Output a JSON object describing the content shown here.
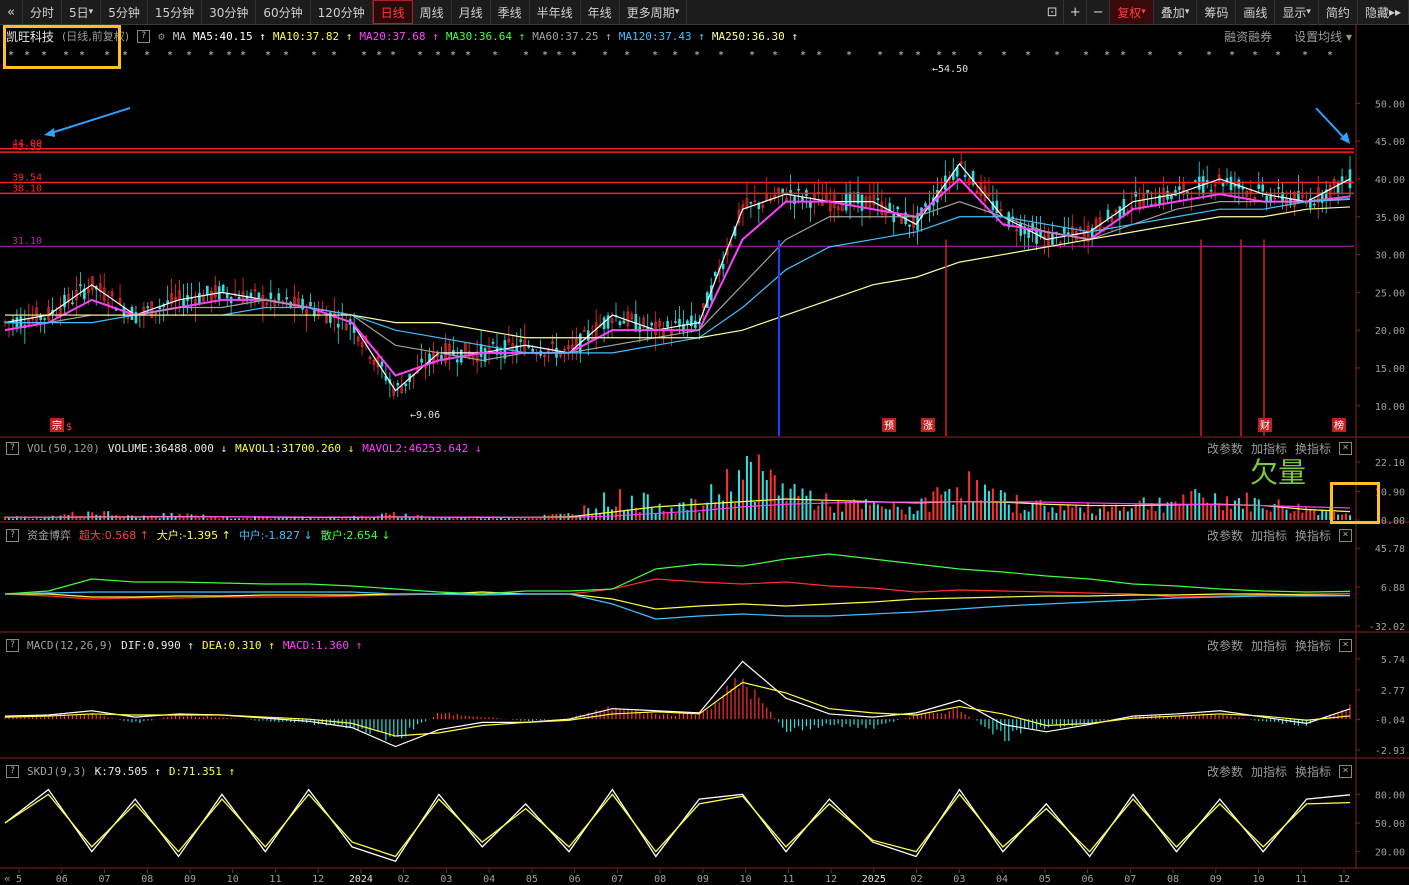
{
  "toolbar": {
    "periods": [
      "分时",
      "5日",
      "5分钟",
      "15分钟",
      "30分钟",
      "60分钟",
      "120分钟",
      "日线",
      "周线",
      "月线",
      "季线",
      "半年线",
      "年线",
      "更多周期"
    ],
    "active_period": "日线",
    "right_items": [
      "复权",
      "叠加",
      "筹码",
      "画线",
      "显示",
      "简约",
      "隐藏"
    ]
  },
  "stock": {
    "name": "凯旺科技",
    "mode": "(日线,前复权)",
    "right_links": [
      "融资融券",
      "设置均线"
    ]
  },
  "ma_legend": [
    {
      "label": "MA",
      "value": "",
      "color": "#c8c8c8"
    },
    {
      "label": "MA5:",
      "value": "40.15",
      "color": "#ffffff"
    },
    {
      "label": "MA10:",
      "value": "37.82",
      "color": "#ffff40"
    },
    {
      "label": "MA20:",
      "value": "37.68",
      "color": "#ff40ff"
    },
    {
      "label": "MA30:",
      "value": "36.64",
      "color": "#40ff40"
    },
    {
      "label": "MA60:",
      "value": "37.25",
      "color": "#a0a0a0"
    },
    {
      "label": "MA120:",
      "value": "37.43",
      "color": "#40c0ff"
    },
    {
      "label": "MA250:",
      "value": "36.30",
      "color": "#ffff9a"
    }
  ],
  "price_levels": [
    {
      "label": "44.00",
      "value": 44.0,
      "color": "#ff2020"
    },
    {
      "label": "43.55",
      "value": 43.55,
      "color": "#ff2020"
    },
    {
      "label": "39.54",
      "value": 39.54,
      "color": "#ff2020"
    },
    {
      "label": "38.10",
      "value": 38.1,
      "color": "#ff2020"
    },
    {
      "label": "31.10",
      "value": 31.1,
      "color": "#c020c0"
    }
  ],
  "price_annotations": {
    "high": "54.50",
    "low": "9.06"
  },
  "event_markers": [
    "宗",
    "$",
    "预",
    "涨",
    "财",
    "榜"
  ],
  "vol_header": {
    "name": "VOL(50,120)",
    "volume": "VOLUME:36488.000",
    "mavol1": "MAVOL1:31700.260",
    "mavol2": "MAVOL2:46253.642"
  },
  "fund_header": {
    "name": "资金博弈",
    "super": "超大:0.568",
    "big": "大户:-1.395",
    "mid": "中户:-1.827",
    "retail": "散户:2.654"
  },
  "macd_header": {
    "name": "MACD(12,26,9)",
    "dif": "DIF:0.990",
    "dea": "DEA:0.310",
    "macd": "MACD:1.360"
  },
  "skdj_header": {
    "name": "SKDJ(9,3)",
    "k": "K:79.505",
    "d": "D:71.351"
  },
  "panel_buttons": [
    "改参数",
    "加指标",
    "换指标"
  ],
  "annotation_text": "欠量",
  "x_axis_labels": [
    "5",
    "06",
    "07",
    "08",
    "09",
    "10",
    "11",
    "12",
    "2024",
    "02",
    "03",
    "04",
    "05",
    "06",
    "07",
    "08",
    "09",
    "10",
    "11",
    "12",
    "2025",
    "02",
    "03",
    "04",
    "05",
    "06",
    "07",
    "08",
    "09",
    "10",
    "11",
    "12"
  ],
  "chart_data": [
    {
      "type": "line",
      "title": "凯旺科技 (日线,前复权)",
      "xlabel": "",
      "ylabel": "",
      "y_ticks": [
        "50.00",
        "45.00",
        "40.00",
        "35.00",
        "30.00",
        "25.00",
        "20.00",
        "15.00",
        "10.00"
      ],
      "ylim": [
        6,
        56
      ],
      "x": [
        "2023-05",
        "2023-06",
        "2023-07",
        "2023-08",
        "2023-09",
        "2023-10",
        "2023-11",
        "2023-12",
        "2024-01",
        "2024-02",
        "2024-03",
        "2024-04",
        "2024-05",
        "2024-06",
        "2024-07",
        "2024-08",
        "2024-09",
        "2024-10",
        "2024-11",
        "2024-12",
        "2025-01",
        "2025-02",
        "2025-03",
        "2025-04",
        "2025-05",
        "2025-06",
        "2025-07",
        "2025-08",
        "2025-09",
        "2025-10",
        "2025-11",
        "2025-12"
      ],
      "series": [
        {
          "name": "MA5",
          "values": [
            21,
            22,
            26,
            22,
            24,
            25,
            24,
            23,
            21,
            12,
            17,
            17,
            18,
            17,
            22,
            20,
            21,
            36,
            38,
            37,
            37,
            34,
            42,
            35,
            32,
            33,
            37,
            38,
            40,
            38,
            37,
            40
          ]
        },
        {
          "name": "MA20",
          "values": [
            20,
            21,
            24,
            22,
            23,
            24,
            24,
            23,
            21,
            14,
            16,
            17,
            17,
            17,
            20,
            20,
            20,
            32,
            37,
            37,
            36,
            35,
            40,
            34,
            33,
            32,
            36,
            37,
            38,
            37,
            37,
            37.7
          ]
        },
        {
          "name": "MA60",
          "values": [
            21,
            21,
            22,
            22,
            23,
            23,
            24,
            23,
            22,
            18,
            17,
            16,
            17,
            17,
            18,
            19,
            20,
            26,
            32,
            35,
            35,
            35,
            37,
            35,
            33,
            32,
            34,
            36,
            37,
            37,
            37,
            37.3
          ]
        },
        {
          "name": "MA120",
          "values": [
            21,
            21,
            21,
            22,
            22,
            22,
            23,
            23,
            22,
            20,
            19,
            18,
            17,
            17,
            17,
            18,
            19,
            23,
            28,
            31,
            32,
            33,
            35,
            35,
            34,
            33,
            34,
            35,
            36,
            36,
            37,
            37.4
          ]
        },
        {
          "name": "MA250",
          "values": [
            22,
            22,
            22,
            22,
            22,
            22,
            22,
            22,
            22,
            21,
            21,
            20,
            19,
            19,
            19,
            19,
            19,
            20,
            22,
            24,
            26,
            27,
            29,
            30,
            31,
            32,
            33,
            34,
            35,
            35,
            36,
            36.3
          ]
        }
      ]
    },
    {
      "type": "bar",
      "title": "VOL(50,120)",
      "y_ticks": [
        "22.10",
        "10.90",
        "0.00"
      ],
      "ylim": [
        0,
        24
      ],
      "x": [
        "2023-05",
        "2023-06",
        "2023-07",
        "2023-08",
        "2023-09",
        "2023-10",
        "2023-11",
        "2023-12",
        "2024-01",
        "2024-02",
        "2024-03",
        "2024-04",
        "2024-05",
        "2024-06",
        "2024-07",
        "2024-08",
        "2024-09",
        "2024-10",
        "2024-11",
        "2024-12",
        "2025-01",
        "2025-02",
        "2025-03",
        "2025-04",
        "2025-05",
        "2025-06",
        "2025-07",
        "2025-08",
        "2025-09",
        "2025-10",
        "2025-11",
        "2025-12"
      ],
      "series": [
        {
          "name": "VOLUME",
          "values": [
            1,
            1,
            3,
            1,
            2,
            1,
            1,
            1,
            1,
            2,
            1,
            1,
            1,
            2,
            8,
            6,
            5,
            18,
            12,
            6,
            5,
            4,
            14,
            7,
            5,
            4,
            6,
            7,
            8,
            6,
            4,
            3.6
          ]
        },
        {
          "name": "MAVOL1",
          "values": [
            1,
            1,
            1.2,
            1.2,
            1.3,
            1.2,
            1.1,
            1,
            1,
            1.2,
            1.1,
            1,
            1,
            1.2,
            3,
            5,
            6,
            7,
            8,
            7.5,
            7,
            6.5,
            7,
            6.8,
            6,
            5.5,
            5.5,
            5.8,
            6,
            5.5,
            4,
            3.2
          ]
        },
        {
          "name": "MAVOL2",
          "values": [
            1,
            1,
            1.1,
            1.1,
            1.2,
            1.2,
            1.2,
            1.1,
            1.1,
            1.1,
            1.1,
            1.1,
            1,
            1,
            1.5,
            2.5,
            3.5,
            5,
            6,
            6.5,
            6.8,
            6.8,
            7,
            7,
            6.8,
            6.5,
            6.2,
            6,
            5.8,
            5.5,
            5,
            4.6
          ]
        }
      ]
    },
    {
      "type": "line",
      "title": "资金博弈",
      "y_ticks": [
        "45.78",
        "6.88",
        "-32.02"
      ],
      "ylim": [
        -36,
        50
      ],
      "x": [
        "2023-05",
        "2023-06",
        "2023-07",
        "2023-08",
        "2023-09",
        "2023-10",
        "2023-11",
        "2023-12",
        "2024-01",
        "2024-02",
        "2024-03",
        "2024-04",
        "2024-05",
        "2024-06",
        "2024-07",
        "2024-08",
        "2024-09",
        "2024-10",
        "2024-11",
        "2024-12",
        "2025-01",
        "2025-02",
        "2025-03",
        "2025-04",
        "2025-05",
        "2025-06",
        "2025-07",
        "2025-08",
        "2025-09",
        "2025-10",
        "2025-11",
        "2025-12"
      ],
      "series": [
        {
          "name": "超大",
          "values": [
            0,
            -2,
            -5,
            -4,
            -4,
            -3,
            -3,
            -3,
            -2,
            -1,
            0,
            0,
            0,
            0,
            5,
            15,
            12,
            10,
            12,
            8,
            6,
            2,
            4,
            3,
            2,
            1,
            0,
            -3,
            -2,
            -1,
            0,
            0.568
          ]
        },
        {
          "name": "大户",
          "values": [
            0,
            0,
            -3,
            -3,
            -2,
            -2,
            -1,
            -1,
            -1,
            0,
            0,
            2,
            0,
            0,
            -5,
            -15,
            -12,
            -10,
            -12,
            -10,
            -8,
            -5,
            -4,
            -3,
            -2,
            -2,
            -1,
            -1,
            0,
            0,
            -1,
            -1.395
          ]
        },
        {
          "name": "中户",
          "values": [
            0,
            1,
            2,
            2,
            2,
            2,
            2,
            2,
            2,
            0,
            0,
            -1,
            0,
            0,
            -10,
            -25,
            -22,
            -20,
            -22,
            -22,
            -20,
            -18,
            -15,
            -12,
            -10,
            -8,
            -6,
            -4,
            -3,
            -2,
            -2,
            -1.827
          ]
        },
        {
          "name": "散户",
          "values": [
            0,
            3,
            15,
            12,
            12,
            11,
            10,
            10,
            8,
            5,
            2,
            0,
            3,
            3,
            5,
            25,
            30,
            28,
            35,
            40,
            35,
            30,
            25,
            22,
            18,
            15,
            10,
            8,
            5,
            3,
            2,
            2.654
          ]
        }
      ]
    },
    {
      "type": "bar",
      "title": "MACD(12,26,9)",
      "y_ticks": [
        "5.74",
        "2.77",
        "-0.04",
        "-2.93"
      ],
      "ylim": [
        -3.5,
        6.2
      ],
      "x": [
        "2023-05",
        "2023-06",
        "2023-07",
        "2023-08",
        "2023-09",
        "2023-10",
        "2023-11",
        "2023-12",
        "2024-01",
        "2024-02",
        "2024-03",
        "2024-04",
        "2024-05",
        "2024-06",
        "2024-07",
        "2024-08",
        "2024-09",
        "2024-10",
        "2024-11",
        "2024-12",
        "2025-01",
        "2025-02",
        "2025-03",
        "2025-04",
        "2025-05",
        "2025-06",
        "2025-07",
        "2025-08",
        "2025-09",
        "2025-10",
        "2025-11",
        "2025-12"
      ],
      "series": [
        {
          "name": "MACD",
          "values": [
            0.2,
            0.3,
            0.6,
            -0.4,
            0.4,
            0.2,
            -0.2,
            -0.4,
            -0.8,
            -2.0,
            0.6,
            0.3,
            -0.2,
            0.1,
            1.2,
            0.5,
            0.6,
            4.0,
            -1.2,
            -0.6,
            -0.8,
            0.4,
            1.0,
            -2.0,
            -0.8,
            -0.4,
            0.4,
            0.3,
            0.6,
            -0.3,
            -0.6,
            1.36
          ]
        },
        {
          "name": "DIF",
          "values": [
            0.3,
            0.4,
            0.8,
            0.2,
            0.5,
            0.4,
            0.1,
            -0.2,
            -0.8,
            -2.6,
            -1.0,
            -0.3,
            -0.3,
            0.0,
            1.0,
            0.8,
            0.6,
            5.5,
            2.0,
            0.5,
            0.2,
            0.6,
            1.8,
            -0.5,
            -1.2,
            -0.5,
            0.3,
            0.5,
            0.8,
            0.2,
            -0.4,
            0.99
          ]
        },
        {
          "name": "DEA",
          "values": [
            0.2,
            0.3,
            0.5,
            0.4,
            0.4,
            0.4,
            0.2,
            0.0,
            -0.4,
            -1.6,
            -1.3,
            -0.6,
            -0.3,
            -0.1,
            0.5,
            0.7,
            0.5,
            3.5,
            2.5,
            1.0,
            0.6,
            0.4,
            1.2,
            0.5,
            -0.6,
            -0.4,
            0.1,
            0.3,
            0.5,
            0.3,
            -0.1,
            0.31
          ]
        }
      ]
    },
    {
      "type": "line",
      "title": "SKDJ(9,3)",
      "y_ticks": [
        "80.00",
        "50.00",
        "20.00"
      ],
      "ylim": [
        5,
        95
      ],
      "x": [
        "2023-05",
        "2023-06",
        "2023-07",
        "2023-08",
        "2023-09",
        "2023-10",
        "2023-11",
        "2023-12",
        "2024-01",
        "2024-02",
        "2024-03",
        "2024-04",
        "2024-05",
        "2024-06",
        "2024-07",
        "2024-08",
        "2024-09",
        "2024-10",
        "2024-11",
        "2024-12",
        "2025-01",
        "2025-02",
        "2025-03",
        "2025-04",
        "2025-05",
        "2025-06",
        "2025-07",
        "2025-08",
        "2025-09",
        "2025-10",
        "2025-11",
        "2025-12"
      ],
      "series": [
        {
          "name": "K",
          "values": [
            50,
            85,
            20,
            75,
            15,
            80,
            20,
            85,
            25,
            10,
            80,
            25,
            70,
            20,
            85,
            15,
            75,
            80,
            20,
            75,
            30,
            15,
            85,
            20,
            70,
            15,
            80,
            20,
            75,
            20,
            75,
            79.505
          ]
        },
        {
          "name": "D",
          "values": [
            50,
            80,
            25,
            70,
            20,
            75,
            25,
            80,
            30,
            15,
            75,
            30,
            65,
            25,
            80,
            20,
            70,
            78,
            25,
            70,
            32,
            20,
            80,
            25,
            65,
            20,
            75,
            25,
            70,
            25,
            70,
            71.351
          ]
        }
      ]
    }
  ]
}
